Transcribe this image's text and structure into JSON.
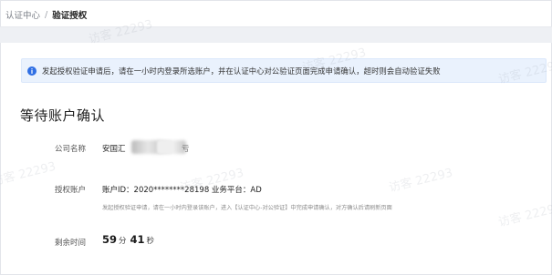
{
  "breadcrumb": {
    "parent": "认证中心",
    "separator": "/",
    "current": "验证授权"
  },
  "notice": {
    "icon": "info-icon",
    "text": "发起授权验证申请后，请在一小时内登录所选账户，并在认证中心对公验证页面完成申请确认，超时则会自动验证失败"
  },
  "title": "等待账户确认",
  "company": {
    "label": "公司名称",
    "value": "安国汇",
    "tail": "亏"
  },
  "account": {
    "label": "授权账户",
    "value": "账户ID：2020********28198 业务平台：AD",
    "hint": "发起授权验证申请，请在一小时内登录该账户，进入【认证中心-对公验证】中完成申请确认，对方确认后请刷新页面"
  },
  "remaining": {
    "label": "剩余时间",
    "minutes": "59",
    "minutes_unit": "分",
    "seconds": "41",
    "seconds_unit": "秒"
  },
  "watermarks": [
    "访客 22293",
    "访客 22293",
    "访客 22293",
    "访客 22293",
    "访客 22293",
    "访客 22293",
    "访客 22293"
  ],
  "colors": {
    "accent": "#2f6fe4",
    "notice_bg": "#eaf2fd",
    "band": "#eef0f4"
  }
}
